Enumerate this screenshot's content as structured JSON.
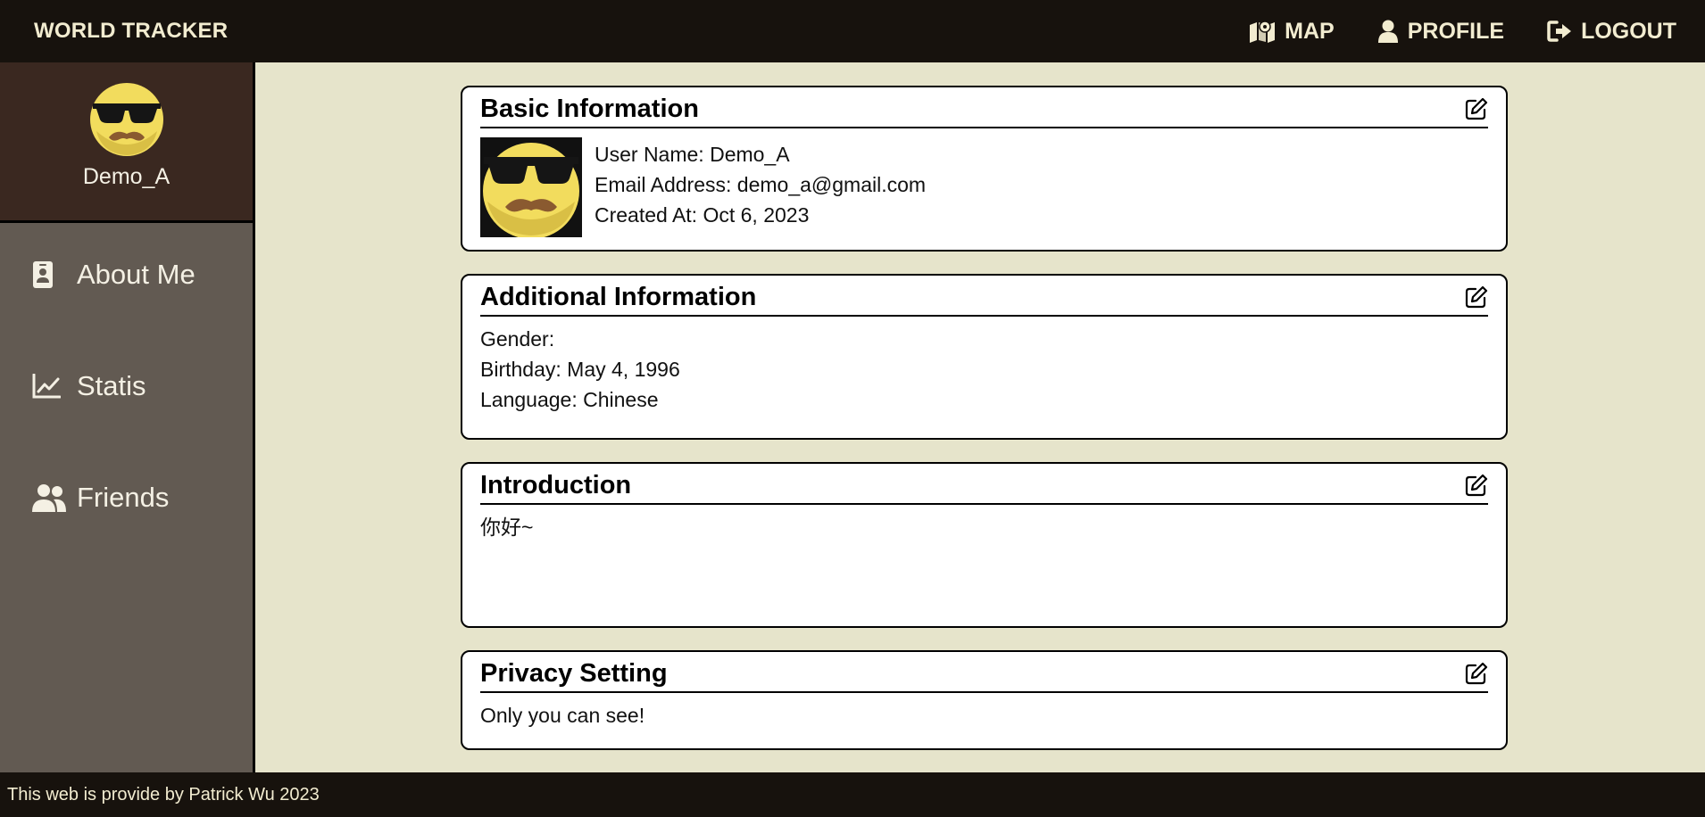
{
  "header": {
    "brand": "WORLD TRACKER",
    "nav": [
      {
        "label": "MAP",
        "icon": "map-icon"
      },
      {
        "label": "PROFILE",
        "icon": "user-icon"
      },
      {
        "label": "LOGOUT",
        "icon": "logout-icon"
      }
    ]
  },
  "sidebar": {
    "user_name": "Demo_A",
    "items": [
      {
        "label": "About Me",
        "icon": "id-badge-icon"
      },
      {
        "label": "Statis",
        "icon": "line-chart-icon"
      },
      {
        "label": "Friends",
        "icon": "users-icon"
      }
    ]
  },
  "cards": {
    "basic": {
      "title": "Basic Information",
      "user_name": "User Name: Demo_A",
      "email": "Email Address: demo_a@gmail.com",
      "created": "Created At: Oct 6, 2023"
    },
    "additional": {
      "title": "Additional Information",
      "gender": "Gender:",
      "birthday": "Birthday: May 4, 1996",
      "language": "Language: Chinese"
    },
    "introduction": {
      "title": "Introduction",
      "text": "你好~"
    },
    "privacy": {
      "title": "Privacy Setting",
      "text": "Only you can see!"
    }
  },
  "footer": {
    "text": "This web is provide by Patrick Wu 2023"
  },
  "colors": {
    "topbar": "#17120d",
    "sidebar": "#625a52",
    "profile_box": "#3a2820",
    "background": "#e6e4cb",
    "avatar_face": "#f2dc5d"
  }
}
